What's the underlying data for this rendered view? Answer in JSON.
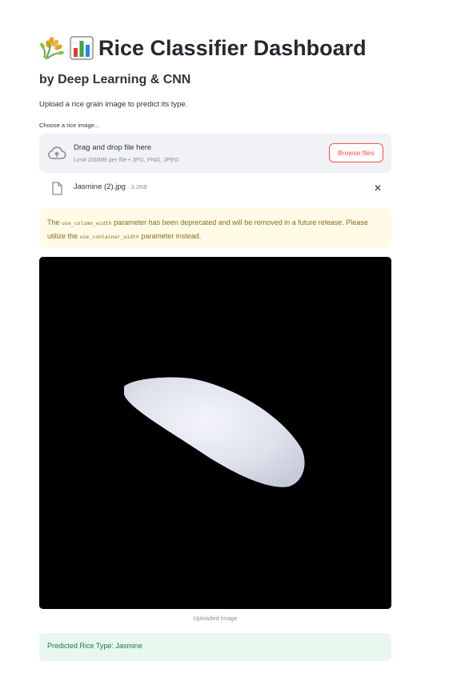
{
  "header": {
    "title_icons": [
      "rice-sheaf-icon",
      "bar-chart-icon"
    ],
    "title": "Rice Classifier Dashboard",
    "subtitle": "by Deep Learning & CNN",
    "description": "Upload a rice grain image to predict its type."
  },
  "uploader": {
    "label": "Choose a rice image...",
    "drop_text": "Drag and drop file here",
    "limit_text": "Limit 200MB per file • JPG, PNG, JPEG",
    "browse_label": "Browse files",
    "file": {
      "name": "Jasmine (2).jpg",
      "size": "3.2KB",
      "remove_symbol": "✕"
    }
  },
  "warning": {
    "text_1": "The ",
    "code_1": "use_column_width",
    "text_2": " parameter has been deprecated and will be removed in a future release. Please utilize the ",
    "code_2": "use_container_width",
    "text_3": " parameter instead."
  },
  "image": {
    "caption": "Uploaded Image"
  },
  "result": {
    "text": "Predicted Rice Type: Jasmine"
  },
  "colors": {
    "accent": "#ff4b4b",
    "warning_bg": "#fffbe7",
    "warning_text": "#8a6d1d",
    "success_bg": "#e9f8ee",
    "success_text": "#1d7a3a",
    "dropzone_bg": "#f0f2f6"
  }
}
